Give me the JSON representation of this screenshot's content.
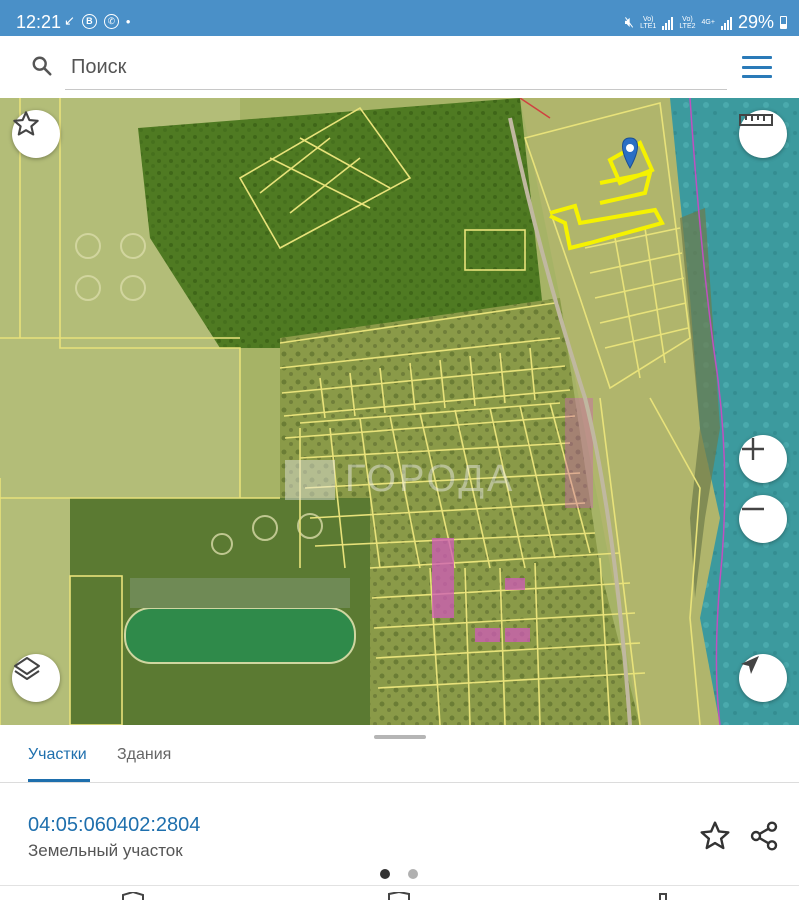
{
  "status_bar": {
    "time": "12:21",
    "battery": "29%",
    "sim1_label": "LTE1",
    "sim2_label": "LTE2",
    "network_label": "4G+"
  },
  "search": {
    "placeholder": "Поиск"
  },
  "map": {
    "watermark_text": "ГОРОДА",
    "selected_parcel_color": "#f5f200",
    "parcel_border_color": "#e8e27a",
    "marker_color": "#2a6fc4"
  },
  "sheet": {
    "tabs": [
      {
        "label": "Участки",
        "active": true
      },
      {
        "label": "Здания",
        "active": false
      }
    ],
    "parcel": {
      "cadastral_number": "04:05:060402:2804",
      "type": "Земельный участок"
    },
    "pager": {
      "pages": 2,
      "current": 1
    }
  },
  "colors": {
    "accent": "#1e6fad",
    "status_bar": "#4a90c8"
  },
  "icons": [
    "search-icon",
    "menu-icon",
    "star-icon",
    "ruler-icon",
    "zoom-in-icon",
    "zoom-out-icon",
    "layers-icon",
    "locate-icon",
    "share-icon",
    "location-pin-icon"
  ]
}
